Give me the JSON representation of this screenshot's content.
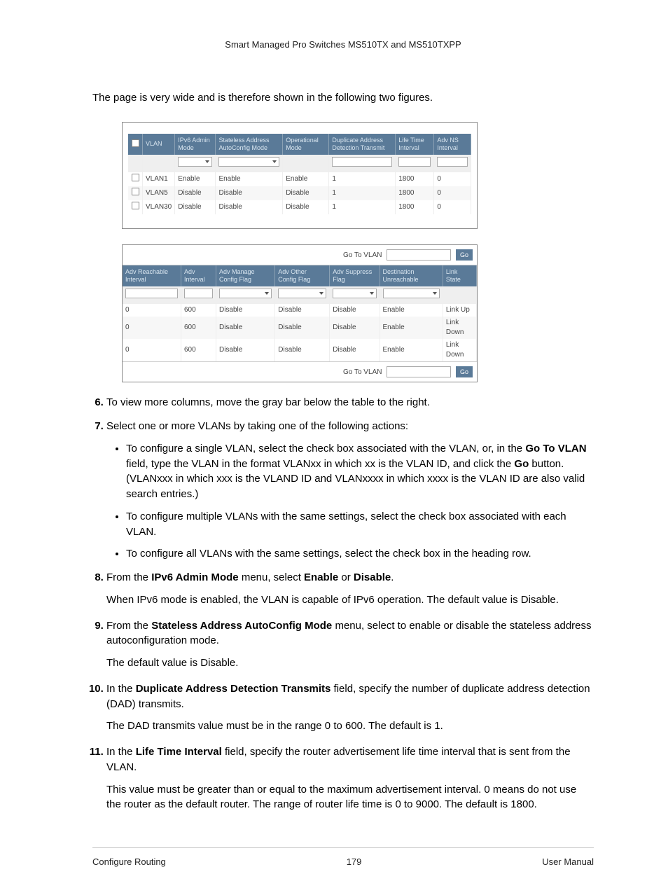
{
  "header": "Smart Managed Pro Switches MS510TX and MS510TXPP",
  "intro": "The page is very wide and is therefore shown in the following two figures.",
  "goto": {
    "label": "Go To VLAN",
    "go": "Go"
  },
  "table1": {
    "headers": [
      "VLAN",
      "IPv6 Admin Mode",
      "Stateless Address AutoConfig Mode",
      "Operational Mode",
      "Duplicate Address Detection Transmit",
      "Life Time Interval",
      "Adv NS Interval"
    ],
    "rows": [
      {
        "vlan": "VLAN1",
        "admin": "Enable",
        "sac": "Enable",
        "op": "Enable",
        "dad": "1",
        "life": "1800",
        "ns": "0"
      },
      {
        "vlan": "VLAN5",
        "admin": "Disable",
        "sac": "Disable",
        "op": "Disable",
        "dad": "1",
        "life": "1800",
        "ns": "0"
      },
      {
        "vlan": "VLAN30",
        "admin": "Disable",
        "sac": "Disable",
        "op": "Disable",
        "dad": "1",
        "life": "1800",
        "ns": "0"
      }
    ]
  },
  "table2": {
    "headers": [
      "Adv Reachable Interval",
      "Adv Interval",
      "Adv Manage Config Flag",
      "Adv Other Config Flag",
      "Adv Suppress Flag",
      "Destination Unreachable",
      "Link State"
    ],
    "rows": [
      {
        "reach": "0",
        "interval": "600",
        "manage": "Disable",
        "other": "Disable",
        "suppress": "Disable",
        "dest": "Enable",
        "link": "Link Up"
      },
      {
        "reach": "0",
        "interval": "600",
        "manage": "Disable",
        "other": "Disable",
        "suppress": "Disable",
        "dest": "Enable",
        "link": "Link Down"
      },
      {
        "reach": "0",
        "interval": "600",
        "manage": "Disable",
        "other": "Disable",
        "suppress": "Disable",
        "dest": "Enable",
        "link": "Link Down"
      }
    ]
  },
  "steps": {
    "s6": "To view more columns, move the gray bar below the table to the right.",
    "s7": {
      "lead": "Select one or more VLANs by taking one of the following actions:",
      "b1a": "To configure a single VLAN, select the check box associated with the VLAN, or, in the ",
      "b1b": "Go To VLAN",
      "b1c": " field, type the VLAN in the format VLANxx in which xx is the VLAN ID, and click the ",
      "b1d": "Go",
      "b1e": " button. (VLANxxx in which xxx is the VLAND ID and VLANxxxx in which xxxx is the VLAN ID are also valid search entries.)",
      "b2": "To configure multiple VLANs with the same settings, select the check box associated with each VLAN.",
      "b3": "To configure all VLANs with the same settings, select the check box in the heading row."
    },
    "s8": {
      "a": "From the ",
      "b": "IPv6 Admin Mode",
      "c": " menu, select ",
      "d": "Enable",
      "e": " or ",
      "f": "Disable",
      "g": ".",
      "p": "When IPv6 mode is enabled, the VLAN is capable of IPv6 operation. The default value is Disable."
    },
    "s9": {
      "a": "From the ",
      "b": "Stateless Address AutoConfig Mode",
      "c": " menu, select to enable or disable the stateless address autoconfiguration mode.",
      "p": "The default value is Disable."
    },
    "s10": {
      "a": "In the ",
      "b": "Duplicate Address Detection Transmits",
      "c": " field, specify the number of duplicate address detection (DAD) transmits.",
      "p": "The DAD transmits value must be in the range 0 to 600. The default is 1."
    },
    "s11": {
      "a": "In the ",
      "b": "Life Time Interval",
      "c": " field, specify the router advertisement life time interval that is sent from the VLAN.",
      "p": "This value must be greater than or equal to the maximum advertisement interval. 0 means do not use the router as the default router. The range of router life time is 0 to 9000. The default is 1800."
    }
  },
  "footer": {
    "left": "Configure Routing",
    "center": "179",
    "right": "User Manual"
  }
}
